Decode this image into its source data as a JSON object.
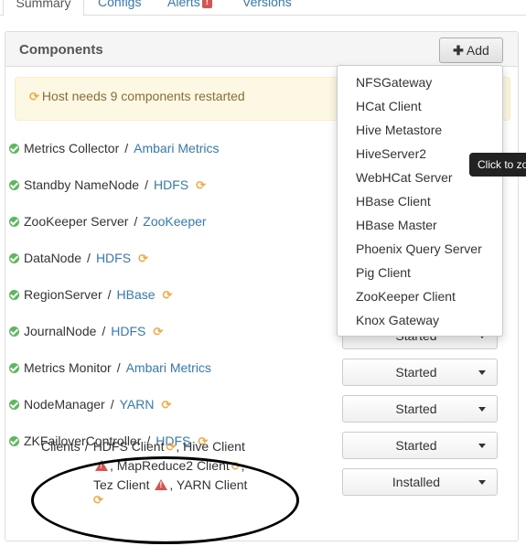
{
  "tabs": [
    {
      "label": "Summary"
    },
    {
      "label": "Configs"
    },
    {
      "label": "Alerts"
    },
    {
      "label": "Versions"
    }
  ],
  "alerts_badge": "!",
  "panel": {
    "title": "Components",
    "add_label": "Add"
  },
  "restart_warning": "Host needs 9 components restarted",
  "components": [
    {
      "name": "Metrics Collector",
      "service": "Ambari Metrics",
      "restart": false,
      "status": ""
    },
    {
      "name": "Standby NameNode",
      "service": "HDFS",
      "restart": true,
      "status": ""
    },
    {
      "name": "ZooKeeper Server",
      "service": "ZooKeeper",
      "restart": false,
      "status": ""
    },
    {
      "name": "DataNode",
      "service": "HDFS",
      "restart": true,
      "status": ""
    },
    {
      "name": "RegionServer",
      "service": "HBase",
      "restart": true,
      "status": ""
    },
    {
      "name": "JournalNode",
      "service": "HDFS",
      "restart": true,
      "status": "Started"
    },
    {
      "name": "Metrics Monitor",
      "service": "Ambari Metrics",
      "restart": false,
      "status": "Started"
    },
    {
      "name": "NodeManager",
      "service": "YARN",
      "restart": true,
      "status": "Started"
    },
    {
      "name": "ZKFailoverController",
      "service": "HDFS",
      "restart": true,
      "status": "Started"
    }
  ],
  "clients": {
    "label": "Clients",
    "hdfs": "HDFS Client",
    "hive": "Hive Client",
    "mapreduce": "MapReduce2 Client",
    "tez": "Tez Client",
    "yarn": "YARN Client",
    "status": "Installed"
  },
  "add_menu": [
    "NFSGateway",
    "HCat Client",
    "Hive Metastore",
    "HiveServer2",
    "WebHCat Server",
    "HBase Client",
    "HBase Master",
    "Phoenix Query Server",
    "Pig Client",
    "ZooKeeper Client",
    "Knox Gateway"
  ],
  "tooltip": "Click to zoom",
  "icons": {
    "check": "check-circle-icon",
    "refresh": "refresh-icon",
    "warning": "warning-icon",
    "caret": "caret-down-icon",
    "plus": "plus-icon"
  },
  "colors": {
    "link": "#337ab7",
    "check": "#5cb85c",
    "refresh": "#f0ad4e",
    "warning": "#d9534f",
    "restart_bg": "#fcf8e3"
  }
}
